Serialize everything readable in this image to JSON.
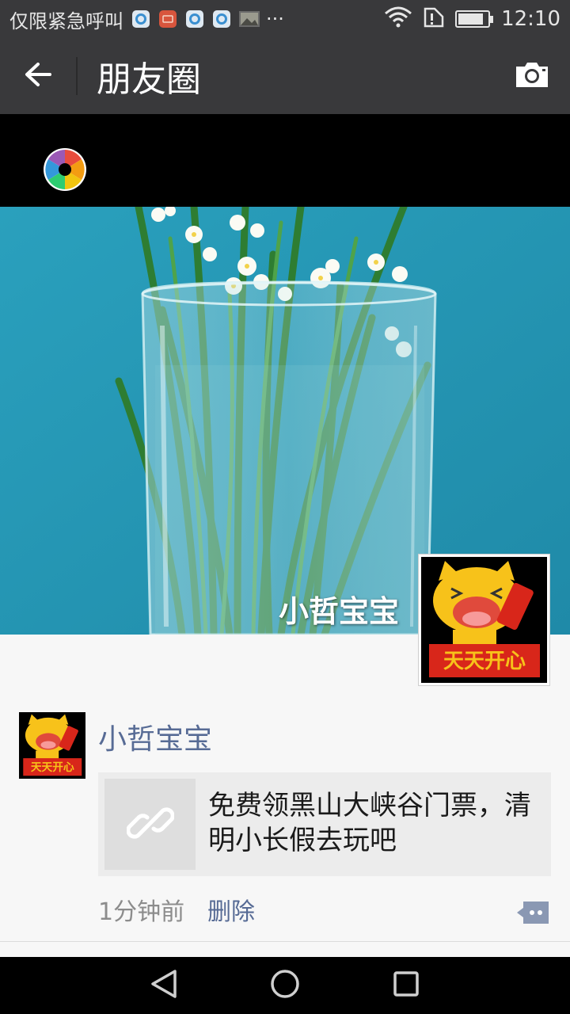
{
  "status_bar": {
    "notification_text": "仅限紧急呼叫",
    "more": "···",
    "time": "12:10",
    "battery_level": 0.85,
    "icons": [
      "notif-browser-icon",
      "notif-mail-icon",
      "notif-browser-icon",
      "notif-browser-icon",
      "notif-photo-icon",
      "wifi-icon",
      "sim-icon",
      "battery-icon"
    ]
  },
  "header": {
    "title": "朋友圈",
    "back_icon": "back-arrow-icon",
    "camera_icon": "camera-icon"
  },
  "cover": {
    "username": "小哲宝宝",
    "background_color": "#2596b3"
  },
  "post": {
    "author": "小哲宝宝",
    "link_title": "免费领黑山大峡谷门票，清明小长假去玩吧",
    "time": "1分钟前",
    "delete_label": "删除",
    "author_color": "#576b95"
  },
  "nav": {
    "icons": [
      "back-triangle-icon",
      "home-circle-icon",
      "recents-square-icon"
    ]
  }
}
